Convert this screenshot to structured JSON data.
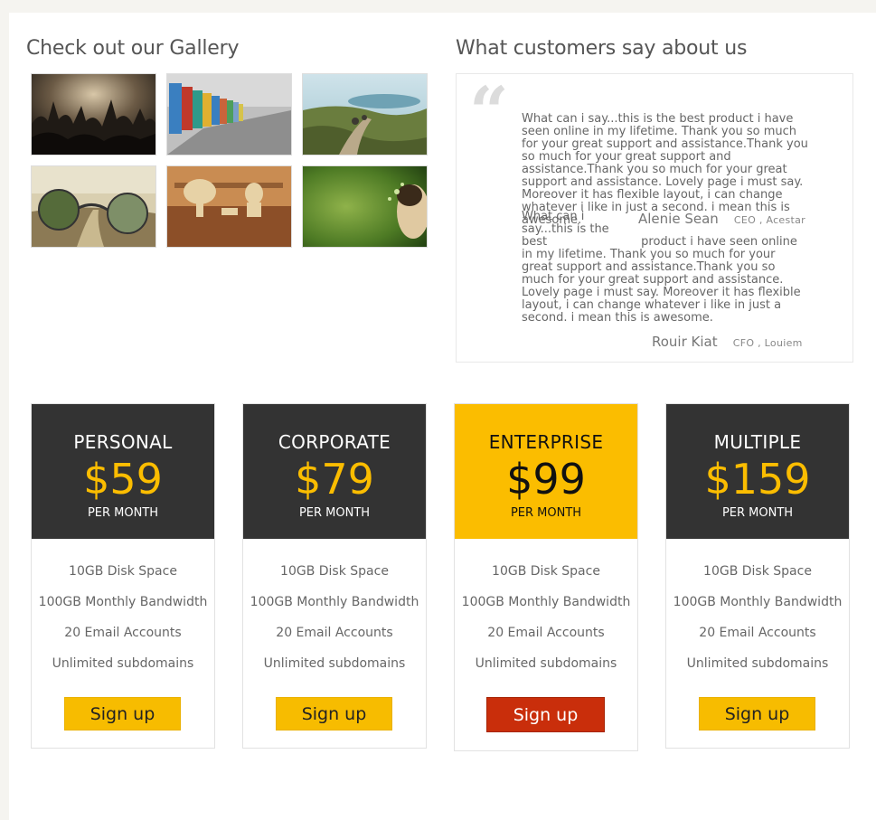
{
  "gallery": {
    "title": "Check out our Gallery",
    "images": [
      {
        "name": "concert-crowd-photo"
      },
      {
        "name": "beach-huts-photo"
      },
      {
        "name": "cyclists-hill-photo"
      },
      {
        "name": "glasses-landscape-photo"
      },
      {
        "name": "wooden-shapes-photo"
      },
      {
        "name": "green-fantasy-photo"
      }
    ]
  },
  "testimonials": {
    "title": "What customers say about us",
    "items": [
      {
        "text": "What can i say...this is the best product i have seen online in my lifetime. Thank you so much for your great support and assistance.Thank you so much for your great support and assistance.Thank you so much for your great support and assistance. Lovely page i must say. Moreover it has flexible layout, i can change whatever i like in just a second. i mean this is awesome.",
        "name": "Alenie Sean",
        "role": "CEO , Acestar"
      },
      {
        "text_start": "What can i say...this is the best",
        "text_rest": "product i have seen online in my lifetime. Thank you so much for your great support and assistance.Thank you so much for your great support and assistance. Lovely page i must say. Moreover it has flexible layout, i can change whatever i like in just a second. i mean this is awesome.",
        "name": "Rouir Kiat",
        "role": "CFO , Louiem"
      }
    ]
  },
  "pricing": {
    "accent_color": "#fbbd00",
    "featured_button_color": "#c92e0b",
    "plans": [
      {
        "name": "PERSONAL",
        "price": "$59",
        "period": "PER MONTH",
        "features": [
          "10GB Disk Space",
          "100GB Monthly Bandwidth",
          "20 Email Accounts",
          "Unlimited subdomains"
        ],
        "button": "Sign up"
      },
      {
        "name": "CORPORATE",
        "price": "$79",
        "period": "PER MONTH",
        "features": [
          "10GB Disk Space",
          "100GB Monthly Bandwidth",
          "20 Email Accounts",
          "Unlimited subdomains"
        ],
        "button": "Sign up"
      },
      {
        "name": "ENTERPRISE",
        "price": "$99",
        "period": "PER MONTH",
        "features": [
          "10GB Disk Space",
          "100GB Monthly Bandwidth",
          "20 Email Accounts",
          "Unlimited subdomains"
        ],
        "button": "Sign up",
        "featured": true
      },
      {
        "name": "MULTIPLE",
        "price": "$159",
        "period": "PER MONTH",
        "features": [
          "10GB Disk Space",
          "100GB Monthly Bandwidth",
          "20 Email Accounts",
          "Unlimited subdomains"
        ],
        "button": "Sign up"
      }
    ]
  }
}
